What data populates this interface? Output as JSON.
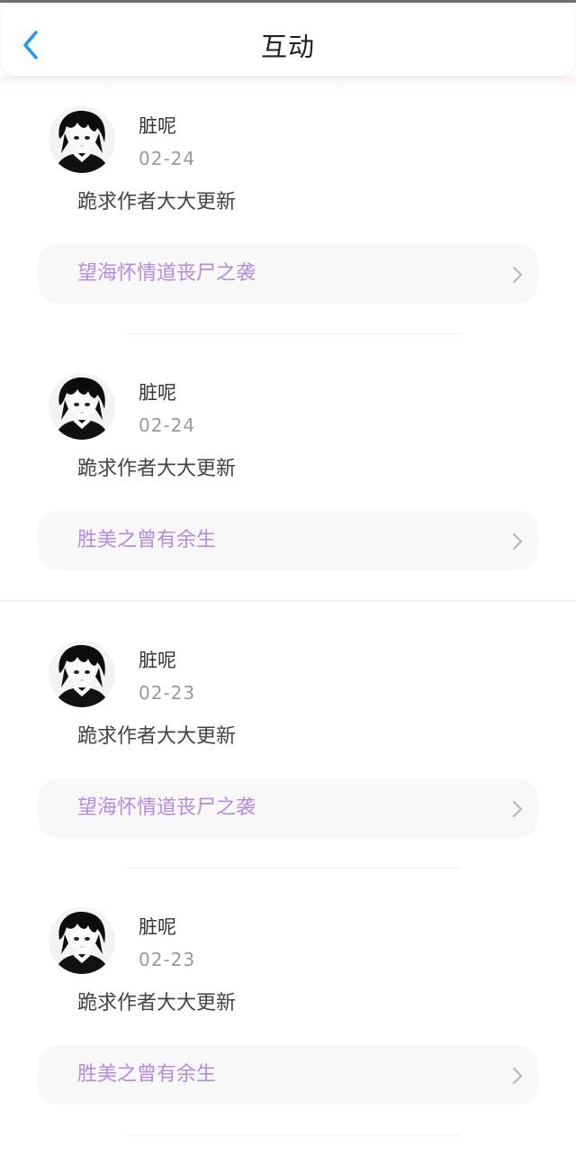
{
  "header": {
    "title": "互动",
    "back_icon": "chevron-left-icon",
    "accent": "#2196f3"
  },
  "colors": {
    "book_link": "#b58be0",
    "date": "#999999"
  },
  "comments": [
    {
      "username": "脏呢",
      "date": "02-24",
      "text": "跪求作者大大更新",
      "book": "望海怀情道丧尸之袭"
    },
    {
      "username": "脏呢",
      "date": "02-24",
      "text": "跪求作者大大更新",
      "book": "胜美之曾有余生"
    },
    {
      "username": "脏呢",
      "date": "02-23",
      "text": "跪求作者大大更新",
      "book": "望海怀情道丧尸之袭"
    },
    {
      "username": "脏呢",
      "date": "02-23",
      "text": "跪求作者大大更新",
      "book": "胜美之曾有余生"
    }
  ]
}
